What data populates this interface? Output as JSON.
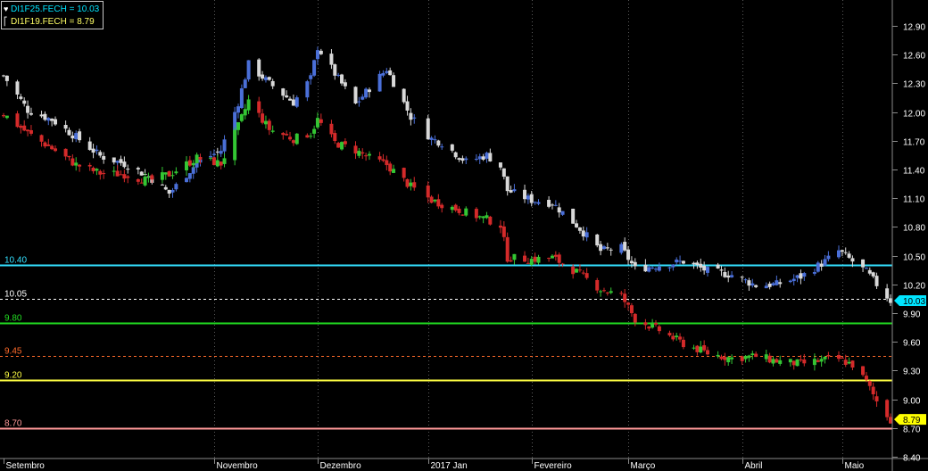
{
  "chart_data": {
    "type": "candlestick",
    "title": "",
    "legend": [
      {
        "icon": "heart-icon",
        "label": "DI1F25.FECH = 10.03",
        "color": "#00e5ff"
      },
      {
        "icon": "bracket-icon",
        "label": "DI1F19.FECH = 8.79",
        "color": "#ffff66"
      }
    ],
    "y_axis": {
      "position": "right",
      "ylim": [
        8.4,
        13.0
      ],
      "ticks": [
        {
          "label": "12.90",
          "value": 12.9
        },
        {
          "label": "12.60",
          "value": 12.6
        },
        {
          "label": "12.30",
          "value": 12.3
        },
        {
          "label": "12.00",
          "value": 12.0
        },
        {
          "label": "11.70",
          "value": 11.7
        },
        {
          "label": "11.40",
          "value": 11.4
        },
        {
          "label": "11.10",
          "value": 11.1
        },
        {
          "label": "10.80",
          "value": 10.8
        },
        {
          "label": "10.50",
          "value": 10.5
        },
        {
          "label": "10.20",
          "value": 10.2
        },
        {
          "label": "9.90",
          "value": 9.9
        },
        {
          "label": "9.60",
          "value": 9.6
        },
        {
          "label": "9.30",
          "value": 9.3
        },
        {
          "label": "9.00",
          "value": 9.0
        },
        {
          "label": "8.70",
          "value": 8.7
        },
        {
          "label": "8.40",
          "value": 8.4
        }
      ]
    },
    "x_axis": {
      "range": [
        "2016-09-01",
        "2017-05-16"
      ],
      "labels": [
        {
          "label": "Setembro",
          "date": "2016-09-01"
        },
        {
          "label": "Novembro",
          "date": "2016-11-01"
        },
        {
          "label": "Dezembro",
          "date": "2016-12-01"
        },
        {
          "label": "2017 Jan",
          "date": "2017-01-02"
        },
        {
          "label": "Fevereiro",
          "date": "2017-02-01"
        },
        {
          "label": "Março",
          "date": "2017-03-01"
        },
        {
          "label": "Abril",
          "date": "2017-04-03"
        },
        {
          "label": "Maio",
          "date": "2017-05-02"
        }
      ]
    },
    "grid": {
      "vertical": true,
      "horizontal": false,
      "style": "dotted"
    },
    "last_value_markers": [
      {
        "label": "10.03",
        "value": 10.03,
        "color": "#00e5ff"
      },
      {
        "label": "8.79",
        "value": 8.79,
        "color": "#ffff00"
      }
    ],
    "horizontal_lines": [
      {
        "label": "10.40",
        "value": 10.4,
        "color": "#33e0ff",
        "style": "solid"
      },
      {
        "label": "10.05",
        "value": 10.05,
        "color": "#ffffff",
        "style": "dashed"
      },
      {
        "label": "9.80",
        "value": 9.8,
        "color": "#22dd22",
        "style": "solid"
      },
      {
        "label": "9.45",
        "value": 9.45,
        "color": "#ff6a2a",
        "style": "dashed"
      },
      {
        "label": "9.20",
        "value": 9.2,
        "color": "#ffff44",
        "style": "solid"
      },
      {
        "label": "8.70",
        "value": 8.7,
        "color": "#ff9999",
        "style": "solid"
      }
    ],
    "series": [
      {
        "name": "DI1F25.FECH",
        "up_color": "#4a6fd8",
        "down_color": "#d8d8d8",
        "anchors": [
          [
            "2016-09-01",
            12.38
          ],
          [
            "2016-09-08",
            12.02
          ],
          [
            "2016-09-15",
            11.92
          ],
          [
            "2016-09-22",
            11.74
          ],
          [
            "2016-09-29",
            11.54
          ],
          [
            "2016-10-06",
            11.46
          ],
          [
            "2016-10-13",
            11.33
          ],
          [
            "2016-10-19",
            11.15
          ],
          [
            "2016-10-27",
            11.47
          ],
          [
            "2016-11-03",
            11.6
          ],
          [
            "2016-11-08",
            12.1
          ],
          [
            "2016-11-11",
            12.5
          ],
          [
            "2016-11-17",
            12.3
          ],
          [
            "2016-11-24",
            12.1
          ],
          [
            "2016-11-29",
            12.35
          ],
          [
            "2016-12-01",
            12.68
          ],
          [
            "2016-12-06",
            12.4
          ],
          [
            "2016-12-12",
            12.08
          ],
          [
            "2016-12-16",
            12.25
          ],
          [
            "2016-12-21",
            12.45
          ],
          [
            "2016-12-28",
            11.95
          ],
          [
            "2017-01-03",
            11.72
          ],
          [
            "2017-01-06",
            11.68
          ],
          [
            "2017-01-13",
            11.48
          ],
          [
            "2017-01-19",
            11.55
          ],
          [
            "2017-01-23",
            11.43
          ],
          [
            "2017-01-25",
            11.18
          ],
          [
            "2017-02-01",
            11.08
          ],
          [
            "2017-02-07",
            11.05
          ],
          [
            "2017-02-14",
            10.82
          ],
          [
            "2017-02-21",
            10.55
          ],
          [
            "2017-02-27",
            10.58
          ],
          [
            "2017-03-03",
            10.36
          ],
          [
            "2017-03-10",
            10.4
          ],
          [
            "2017-03-17",
            10.44
          ],
          [
            "2017-03-24",
            10.34
          ],
          [
            "2017-03-31",
            10.3
          ],
          [
            "2017-04-07",
            10.19
          ],
          [
            "2017-04-13",
            10.2
          ],
          [
            "2017-04-20",
            10.28
          ],
          [
            "2017-04-27",
            10.44
          ],
          [
            "2017-05-01",
            10.55
          ],
          [
            "2017-05-05",
            10.44
          ],
          [
            "2017-05-09",
            10.33
          ],
          [
            "2017-05-12",
            10.2
          ],
          [
            "2017-05-16",
            10.03
          ]
        ]
      },
      {
        "name": "DI1F19.FECH",
        "up_color": "#33c633",
        "down_color": "#d42a2a",
        "anchors": [
          [
            "2016-09-01",
            11.98
          ],
          [
            "2016-09-08",
            11.78
          ],
          [
            "2016-09-15",
            11.62
          ],
          [
            "2016-09-22",
            11.45
          ],
          [
            "2016-09-29",
            11.36
          ],
          [
            "2016-10-06",
            11.35
          ],
          [
            "2016-10-13",
            11.28
          ],
          [
            "2016-10-19",
            11.35
          ],
          [
            "2016-10-27",
            11.52
          ],
          [
            "2016-11-03",
            11.46
          ],
          [
            "2016-11-08",
            11.85
          ],
          [
            "2016-11-11",
            12.12
          ],
          [
            "2016-11-17",
            11.82
          ],
          [
            "2016-11-24",
            11.72
          ],
          [
            "2016-11-29",
            11.78
          ],
          [
            "2016-12-01",
            11.92
          ],
          [
            "2016-12-06",
            11.68
          ],
          [
            "2016-12-12",
            11.6
          ],
          [
            "2016-12-16",
            11.52
          ],
          [
            "2016-12-21",
            11.45
          ],
          [
            "2016-12-28",
            11.22
          ],
          [
            "2017-01-03",
            11.08
          ],
          [
            "2017-01-06",
            11.04
          ],
          [
            "2017-01-13",
            10.95
          ],
          [
            "2017-01-19",
            10.88
          ],
          [
            "2017-01-23",
            10.82
          ],
          [
            "2017-01-25",
            10.48
          ],
          [
            "2017-02-01",
            10.46
          ],
          [
            "2017-02-07",
            10.48
          ],
          [
            "2017-02-14",
            10.33
          ],
          [
            "2017-02-21",
            10.15
          ],
          [
            "2017-02-27",
            10.08
          ],
          [
            "2017-03-03",
            9.84
          ],
          [
            "2017-03-10",
            9.72
          ],
          [
            "2017-03-17",
            9.58
          ],
          [
            "2017-03-24",
            9.48
          ],
          [
            "2017-03-31",
            9.43
          ],
          [
            "2017-04-07",
            9.45
          ],
          [
            "2017-04-13",
            9.4
          ],
          [
            "2017-04-20",
            9.37
          ],
          [
            "2017-04-27",
            9.41
          ],
          [
            "2017-05-01",
            9.42
          ],
          [
            "2017-05-05",
            9.36
          ],
          [
            "2017-05-09",
            9.18
          ],
          [
            "2017-05-12",
            8.98
          ],
          [
            "2017-05-16",
            8.79
          ]
        ]
      }
    ]
  }
}
